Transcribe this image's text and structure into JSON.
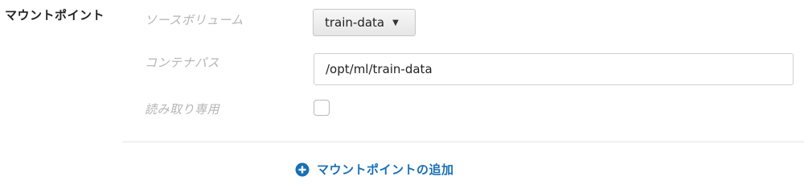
{
  "section": {
    "title": "マウントポイント"
  },
  "fields": {
    "source_volume_label": "ソースボリューム",
    "source_volume_value": "train-data",
    "container_path_label": "コンテナパス",
    "container_path_value": "/opt/ml/train-data",
    "read_only_label": "読み取り専用",
    "read_only_checked": false
  },
  "actions": {
    "add_mount_point_label": "マウントポイントの追加",
    "add_icon": "plus-circle-icon"
  },
  "colors": {
    "link": "#1a6fb3",
    "label_muted": "#b5b5b5"
  }
}
